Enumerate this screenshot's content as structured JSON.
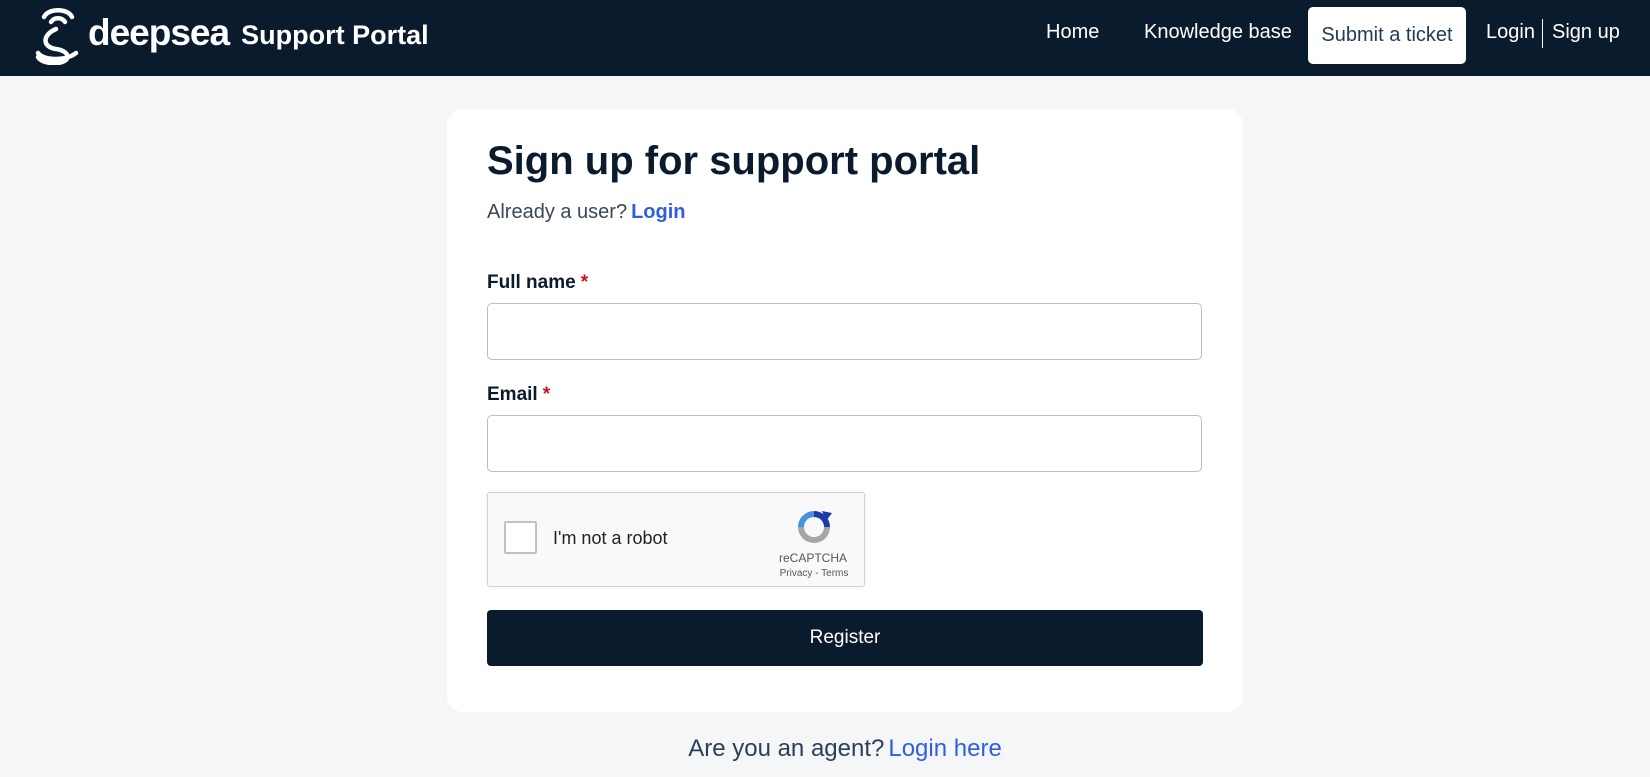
{
  "header": {
    "brand_word": "deepsea",
    "brand_portal": "Support Portal",
    "logo_icon": "deepsea-logo-icon",
    "nav": {
      "home": "Home",
      "knowledge_base": "Knowledge base",
      "submit_ticket": "Submit a ticket",
      "login": "Login",
      "signup": "Sign up"
    }
  },
  "form": {
    "title": "Sign up for support portal",
    "already_user": "Already a user?",
    "login_link": "Login",
    "full_name_label": "Full name",
    "email_label": "Email",
    "required_mark": "*",
    "full_name_value": "",
    "email_value": "",
    "register_label": "Register"
  },
  "captcha": {
    "text": "I'm not a robot",
    "brand": "reCAPTCHA",
    "terms": "Privacy - Terms",
    "checked": false
  },
  "footer": {
    "agent_question": "Are you an agent?",
    "agent_link": "Login here"
  },
  "colors": {
    "navy": "#0b1b2e",
    "link_blue": "#2f5fe0",
    "required_red": "#c2121e",
    "background": "#f5f6f8"
  }
}
